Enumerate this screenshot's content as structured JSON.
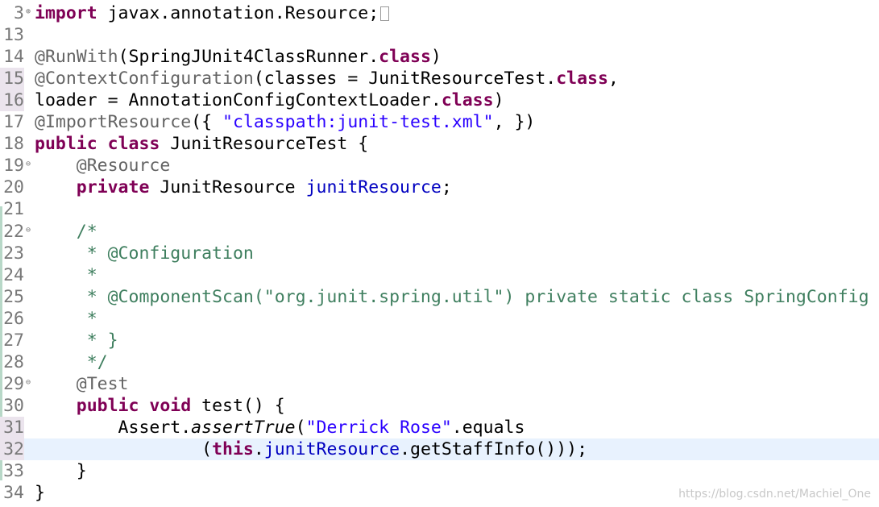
{
  "editor": {
    "lines": [
      {
        "num": "3",
        "fold": "⊕",
        "mod": false,
        "current": false,
        "tokens": [
          {
            "t": "import",
            "c": "kw"
          },
          {
            "t": " javax.annotation.Resource;",
            "c": ""
          }
        ],
        "collapsed": true
      },
      {
        "num": "13",
        "fold": "",
        "mod": false,
        "current": false,
        "tokens": []
      },
      {
        "num": "14",
        "fold": "",
        "mod": false,
        "current": false,
        "tokens": [
          {
            "t": "@RunWith",
            "c": "ann"
          },
          {
            "t": "(SpringJUnit4ClassRunner.",
            "c": ""
          },
          {
            "t": "class",
            "c": "kw"
          },
          {
            "t": ")",
            "c": ""
          }
        ]
      },
      {
        "num": "15",
        "fold": "",
        "mod": true,
        "current": false,
        "tokens": [
          {
            "t": "@ContextConfiguration",
            "c": "ann"
          },
          {
            "t": "(classes = JunitResourceTest.",
            "c": ""
          },
          {
            "t": "class",
            "c": "kw"
          },
          {
            "t": ",",
            "c": ""
          }
        ]
      },
      {
        "num": "16",
        "fold": "",
        "mod": true,
        "current": false,
        "tokens": [
          {
            "t": "loader = AnnotationConfigContextLoader.",
            "c": ""
          },
          {
            "t": "class",
            "c": "kw"
          },
          {
            "t": ")",
            "c": ""
          }
        ]
      },
      {
        "num": "17",
        "fold": "",
        "mod": false,
        "current": false,
        "tokens": [
          {
            "t": "@ImportResource",
            "c": "ann"
          },
          {
            "t": "({ ",
            "c": ""
          },
          {
            "t": "\"classpath:junit-test.xml\"",
            "c": "str"
          },
          {
            "t": ", })",
            "c": ""
          }
        ]
      },
      {
        "num": "18",
        "fold": "",
        "mod": false,
        "current": false,
        "tokens": [
          {
            "t": "public",
            "c": "kw"
          },
          {
            "t": " ",
            "c": ""
          },
          {
            "t": "class",
            "c": "kw"
          },
          {
            "t": " JunitResourceTest {",
            "c": ""
          }
        ]
      },
      {
        "num": "19",
        "fold": "⊖",
        "mod": false,
        "current": false,
        "tokens": [
          {
            "t": "    @Resource",
            "c": "ann"
          }
        ]
      },
      {
        "num": "20",
        "fold": "",
        "mod": false,
        "current": false,
        "tokens": [
          {
            "t": "    ",
            "c": ""
          },
          {
            "t": "private",
            "c": "kw"
          },
          {
            "t": " JunitResource ",
            "c": ""
          },
          {
            "t": "junitResource",
            "c": "fld"
          },
          {
            "t": ";",
            "c": ""
          }
        ]
      },
      {
        "num": "21",
        "fold": "",
        "mod": false,
        "current": false,
        "tokens": []
      },
      {
        "num": "22",
        "fold": "⊖",
        "mod": false,
        "current": false,
        "tokens": [
          {
            "t": "    /*",
            "c": "com"
          }
        ]
      },
      {
        "num": "23",
        "fold": "",
        "mod": false,
        "current": false,
        "tokens": [
          {
            "t": "     * @Configuration",
            "c": "com"
          }
        ]
      },
      {
        "num": "24",
        "fold": "",
        "mod": false,
        "current": false,
        "tokens": [
          {
            "t": "     *",
            "c": "com"
          }
        ]
      },
      {
        "num": "25",
        "fold": "",
        "mod": false,
        "current": false,
        "tokens": [
          {
            "t": "     * @ComponentScan(\"org.junit.spring.util\") private static class SpringConfig",
            "c": "com"
          }
        ]
      },
      {
        "num": "26",
        "fold": "",
        "mod": false,
        "current": false,
        "tokens": [
          {
            "t": "     *",
            "c": "com"
          }
        ]
      },
      {
        "num": "27",
        "fold": "",
        "mod": false,
        "current": false,
        "tokens": [
          {
            "t": "     * }",
            "c": "com"
          }
        ]
      },
      {
        "num": "28",
        "fold": "",
        "mod": false,
        "current": false,
        "tokens": [
          {
            "t": "     */",
            "c": "com"
          }
        ]
      },
      {
        "num": "29",
        "fold": "⊖",
        "mod": false,
        "current": false,
        "tokens": [
          {
            "t": "    @Test",
            "c": "ann"
          }
        ]
      },
      {
        "num": "30",
        "fold": "",
        "mod": false,
        "current": false,
        "tokens": [
          {
            "t": "    ",
            "c": ""
          },
          {
            "t": "public",
            "c": "kw"
          },
          {
            "t": " ",
            "c": ""
          },
          {
            "t": "void",
            "c": "kw"
          },
          {
            "t": " test() {",
            "c": ""
          }
        ]
      },
      {
        "num": "31",
        "fold": "",
        "mod": true,
        "current": false,
        "tokens": [
          {
            "t": "        Assert.",
            "c": ""
          },
          {
            "t": "assertTrue",
            "c": "ital"
          },
          {
            "t": "(",
            "c": ""
          },
          {
            "t": "\"Derrick Rose\"",
            "c": "str"
          },
          {
            "t": ".equals",
            "c": ""
          }
        ]
      },
      {
        "num": "32",
        "fold": "",
        "mod": true,
        "current": true,
        "tokens": [
          {
            "t": "                (",
            "c": ""
          },
          {
            "t": "this",
            "c": "kw"
          },
          {
            "t": ".",
            "c": ""
          },
          {
            "t": "junitResource",
            "c": "fld"
          },
          {
            "t": ".getStaffInfo()));",
            "c": ""
          }
        ]
      },
      {
        "num": "33",
        "fold": "",
        "mod": false,
        "current": false,
        "tokens": [
          {
            "t": "    }",
            "c": ""
          }
        ]
      },
      {
        "num": "34",
        "fold": "",
        "mod": false,
        "current": false,
        "tokens": [
          {
            "t": "}",
            "c": ""
          }
        ]
      }
    ]
  },
  "watermark": "https://blog.csdn.net/Machiel_One",
  "colors": {
    "keyword": "#7f0055",
    "annotation": "#646464",
    "string": "#2a00ff",
    "field": "#0000c0",
    "comment": "#3f7f5f",
    "current_line": "#e8f2fe"
  }
}
